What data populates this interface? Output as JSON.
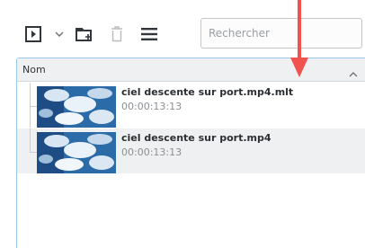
{
  "toolbar": {
    "buttons": [
      {
        "name": "add-clip-icon"
      },
      {
        "name": "chevron-down-icon"
      },
      {
        "name": "add-folder-icon"
      },
      {
        "name": "trash-icon"
      },
      {
        "name": "hamburger-menu-icon"
      }
    ],
    "search_placeholder": "Rechercher"
  },
  "bin": {
    "column_header": "Nom",
    "items": [
      {
        "title": "ciel descente sur port.mp4.mlt",
        "duration": "00:00:13:13"
      },
      {
        "title": "ciel descente sur port.mp4",
        "duration": "00:00:13:13"
      }
    ]
  },
  "colors": {
    "accent": "#3daee9",
    "arrow": "#f0524d",
    "selected_row": "#eff0f1"
  }
}
